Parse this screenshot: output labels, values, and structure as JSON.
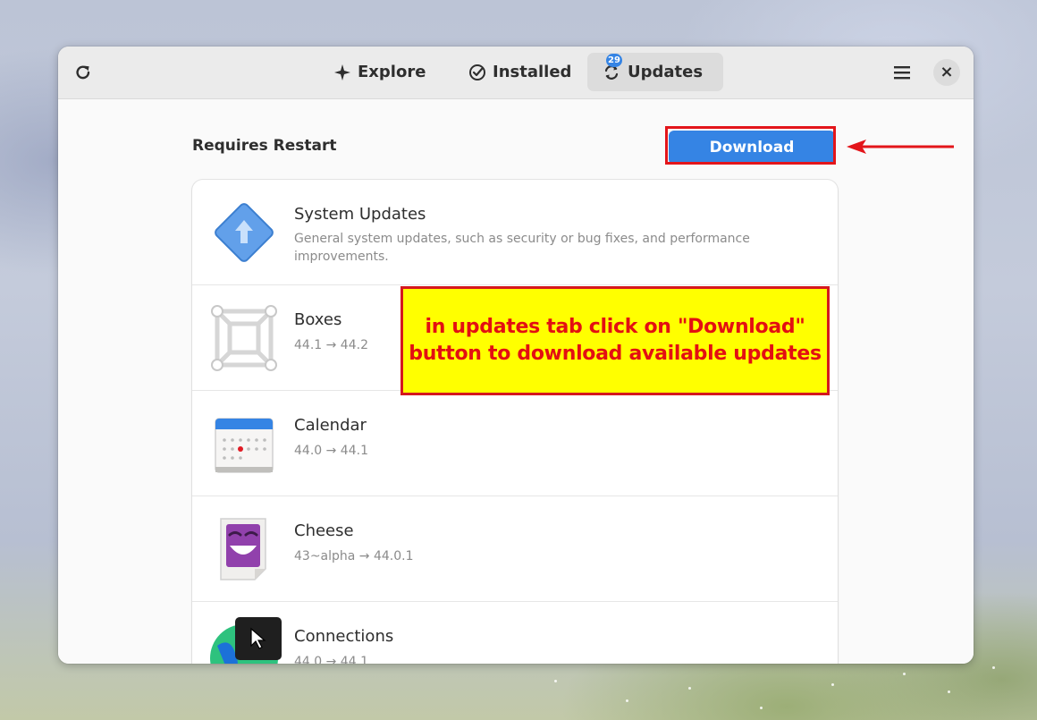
{
  "window": {
    "tabs": [
      {
        "label": "Explore",
        "icon": "explore-icon",
        "active": false
      },
      {
        "label": "Installed",
        "icon": "check-circle-icon",
        "active": false
      },
      {
        "label": "Updates",
        "icon": "update-icon",
        "active": true,
        "badge": "29"
      }
    ],
    "close_glyph": "×"
  },
  "updates": {
    "section_title": "Requires Restart",
    "download_label": "Download",
    "items": [
      {
        "name": "System Updates",
        "description": "General system updates, such as security or bug fixes, and performance improvements.",
        "icon": "system-updates-icon"
      },
      {
        "name": "Boxes",
        "version": "44.1 → 44.2",
        "icon": "boxes-icon"
      },
      {
        "name": "Calendar",
        "version": "44.0 → 44.1",
        "icon": "calendar-icon"
      },
      {
        "name": "Cheese",
        "version": "43~alpha → 44.0.1",
        "icon": "cheese-icon"
      },
      {
        "name": "Connections",
        "version": "44.0 → 44.1",
        "icon": "connections-icon"
      }
    ]
  },
  "annotation": {
    "line1": "in updates tab click on \"Download\"",
    "line2": "button to download available updates"
  },
  "colors": {
    "accent": "#3584e4",
    "annotation_bg": "#ffff00",
    "annotation_text": "#e30f12",
    "highlight_border": "#e3151a"
  }
}
